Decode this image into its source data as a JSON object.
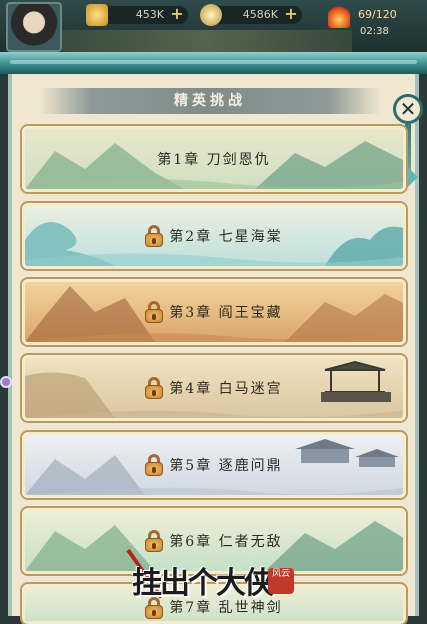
{
  "topbar": {
    "gold_amount": "453K",
    "coin_amount": "4586K",
    "energy": "69/120",
    "timer": "02:38"
  },
  "panel": {
    "title": "精英挑战",
    "close_label": "✕"
  },
  "chapters": [
    {
      "label": "第1章 刀剑恩仇",
      "locked": false
    },
    {
      "label": "第2章 七星海棠",
      "locked": true
    },
    {
      "label": "第3章 阎王宝藏",
      "locked": true
    },
    {
      "label": "第4章 白马迷宫",
      "locked": true
    },
    {
      "label": "第5章 逐鹿问鼎",
      "locked": true
    },
    {
      "label": "第6章 仁者无敌",
      "locked": true
    },
    {
      "label": "第7章 乱世神剑",
      "locked": true
    }
  ],
  "logo": {
    "text": "挂出个大侠",
    "stamp": "风云"
  },
  "colors": {
    "scroll_rod": "#3a8d8d",
    "paper": "#efe7cf",
    "lock": "#c98431"
  }
}
